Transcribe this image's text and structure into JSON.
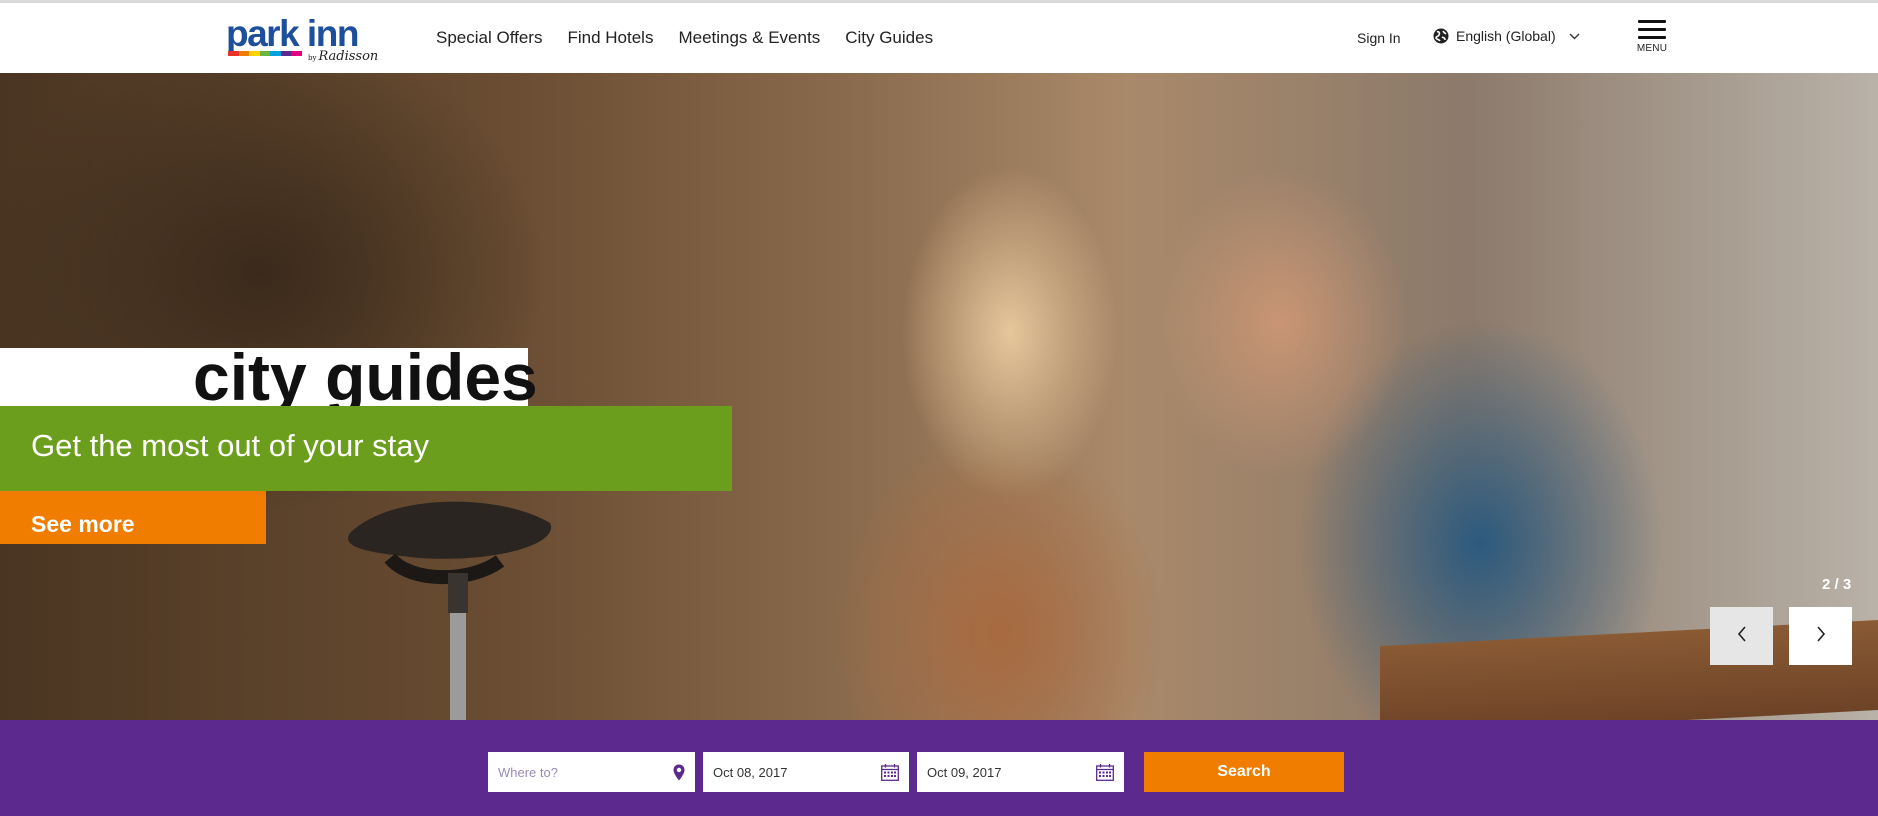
{
  "header": {
    "logo": {
      "text": "park inn",
      "by": "by",
      "brand": "Radisson"
    },
    "nav": [
      {
        "label": "Special Offers"
      },
      {
        "label": "Find Hotels"
      },
      {
        "label": "Meetings & Events"
      },
      {
        "label": "City Guides"
      }
    ],
    "sign_in": "Sign In",
    "language": {
      "icon": "globe-icon",
      "label": "English (Global)"
    },
    "menu": {
      "icon": "hamburger-icon",
      "label": "MENU"
    }
  },
  "hero": {
    "title": "city guides",
    "subtitle": "Get the most out of your stay",
    "cta": "See more",
    "slide_counter": "2 / 3",
    "prev_icon": "chevron-left-icon",
    "next_icon": "chevron-right-icon"
  },
  "search": {
    "where": {
      "value": "",
      "placeholder": "Where to?",
      "icon": "map-pin-icon"
    },
    "checkin": {
      "value": "Oct 08, 2017",
      "icon": "calendar-icon"
    },
    "checkout": {
      "value": "Oct 09, 2017",
      "icon": "calendar-icon"
    },
    "button": "Search"
  },
  "colors": {
    "brand_blue": "#1d4f9c",
    "accent_orange": "#f07d00",
    "accent_green": "#6c9e1e",
    "search_purple": "#5c2a8e",
    "logo_stripes": [
      "#e8332a",
      "#f07d00",
      "#ffd200",
      "#6cb33f",
      "#00a0dc",
      "#5c2a8e",
      "#e6007e"
    ]
  }
}
